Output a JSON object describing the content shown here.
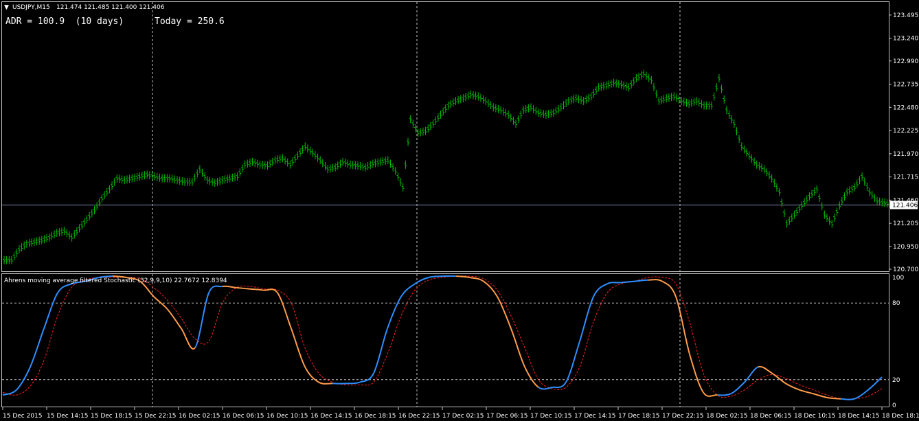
{
  "colors": {
    "background": "#000000",
    "frame": "#c8c8c8",
    "bars": "#00c000",
    "price_line": "#7f8fb6",
    "label_fill": "#ffffff",
    "label_text": "#000000",
    "ind_rising": "#2e8fff",
    "ind_falling": "#ff9c4a",
    "signal": "#ff2020",
    "grid": "#c8c8c8"
  },
  "header": {
    "arrow": "▼",
    "title": "USDJPY,M15",
    "ohlc": "121.474 121.485 121.400 121.406"
  },
  "adr": {
    "adr_text": "ADR = 100.9  (10 days)",
    "today_text": "Today = 250.6"
  },
  "price_axis": {
    "ticks": [
      "123.495",
      "123.240",
      "122.990",
      "122.735",
      "122.480",
      "122.225",
      "121.970",
      "121.715",
      "121.460",
      "121.205",
      "120.950",
      "120.700"
    ],
    "current_price": "121.406"
  },
  "indicator": {
    "label": "Ahrens moving average filtered Stochastic (32,9,9,10) 22.7672 12.8394",
    "axis_labels": [
      "100",
      "80",
      "20",
      "0"
    ]
  },
  "time_axis": [
    "15 Dec 2015",
    "15 Dec 14:15",
    "15 Dec 18:15",
    "15 Dec 22:15",
    "16 Dec 02:15",
    "16 Dec 06:15",
    "16 Dec 10:15",
    "16 Dec 14:15",
    "16 Dec 18:15",
    "16 Dec 22:15",
    "17 Dec 02:15",
    "17 Dec 06:15",
    "17 Dec 10:15",
    "17 Dec 14:15",
    "17 Dec 18:15",
    "17 Dec 22:15",
    "18 Dec 02:15",
    "18 Dec 06:15",
    "18 Dec 10:15",
    "18 Dec 14:15",
    "18 Dec 18:15"
  ],
  "chart_data": [
    {
      "type": "line",
      "title": "USDJPY,M15",
      "ylim": [
        120.7,
        123.6
      ],
      "series": [
        {
          "name": "USDJPY",
          "values": [
            120.8,
            120.92,
            120.98,
            121.0,
            121.02,
            121.05,
            121.1,
            121.12,
            121.05,
            121.15,
            121.25,
            121.35,
            121.48,
            121.58,
            121.7,
            121.68,
            121.7,
            121.72,
            121.74,
            121.72,
            121.7,
            121.7,
            121.68,
            121.66,
            121.66,
            121.8,
            121.68,
            121.65,
            121.68,
            121.7,
            121.72,
            121.85,
            121.88,
            121.85,
            121.84,
            121.9,
            121.92,
            121.85,
            121.95,
            122.05,
            121.98,
            121.9,
            121.8,
            121.82,
            121.88,
            121.85,
            121.84,
            121.82,
            121.86,
            121.88,
            121.9,
            121.78,
            121.6,
            122.35,
            122.2,
            122.22,
            122.3,
            122.4,
            122.5,
            122.55,
            122.58,
            122.62,
            122.6,
            122.55,
            122.48,
            122.45,
            122.4,
            122.3,
            122.45,
            122.48,
            122.42,
            122.4,
            122.42,
            122.48,
            122.55,
            122.58,
            122.55,
            122.6,
            122.7,
            122.72,
            122.75,
            122.73,
            122.7,
            122.8,
            122.85,
            122.78,
            122.55,
            122.58,
            122.6,
            122.55,
            122.52,
            122.55,
            122.5,
            122.5,
            122.8,
            122.45,
            122.3,
            122.05,
            121.95,
            121.85,
            121.8,
            121.7,
            121.55,
            121.2,
            121.3,
            121.4,
            121.5,
            121.58,
            121.3,
            121.2,
            121.4,
            121.55,
            121.6,
            121.72,
            121.55,
            121.45,
            121.43,
            121.41
          ]
        }
      ]
    },
    {
      "type": "line",
      "title": "Ahrens moving average filtered Stochastic (32,9,9,10)",
      "ylim": [
        0,
        100
      ],
      "series": [
        {
          "name": "Stochastic",
          "values": [
            8,
            12,
            30,
            60,
            88,
            95,
            97,
            100,
            101,
            100,
            97,
            85,
            75,
            60,
            45,
            88,
            93,
            92,
            91,
            90,
            88,
            60,
            30,
            18,
            17,
            17,
            18,
            25,
            60,
            85,
            95,
            100,
            101,
            101,
            100,
            97,
            85,
            60,
            30,
            14,
            14,
            18,
            50,
            85,
            95,
            96,
            97,
            98,
            97,
            85,
            40,
            10,
            8,
            9,
            18,
            30,
            25,
            17,
            12,
            9,
            6,
            5,
            5,
            12,
            22
          ]
        },
        {
          "name": "Signal",
          "values": [
            10,
            8,
            15,
            35,
            70,
            92,
            98,
            100,
            100,
            100,
            99,
            92,
            82,
            68,
            52,
            50,
            80,
            92,
            93,
            91,
            90,
            80,
            45,
            25,
            18,
            16,
            16,
            18,
            40,
            70,
            90,
            98,
            100,
            101,
            101,
            99,
            90,
            70,
            45,
            20,
            13,
            14,
            30,
            65,
            88,
            95,
            97,
            100,
            100,
            95,
            65,
            25,
            8,
            7,
            12,
            20,
            24,
            21,
            16,
            12,
            8,
            5,
            5,
            7,
            13
          ]
        }
      ]
    }
  ]
}
